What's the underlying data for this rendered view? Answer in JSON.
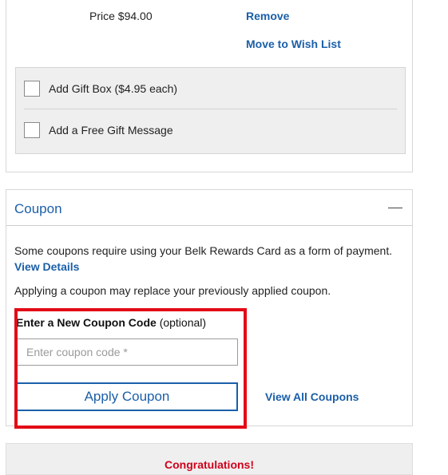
{
  "item": {
    "price": "Price $94.00",
    "remove_label": "Remove",
    "move_to_wishlist_label": "Move to Wish List"
  },
  "gift_options": [
    {
      "label": "Add Gift Box ($4.95 each)",
      "checked": false
    },
    {
      "label": "Add a Free Gift Message",
      "checked": false
    }
  ],
  "coupon": {
    "title": "Coupon",
    "info_text": "Some coupons require using your Belk Rewards Card as a form of payment.",
    "view_details_label": "View Details",
    "replace_notice": "Applying a coupon may replace your previously applied coupon.",
    "entry_label_bold": "Enter a New Coupon Code",
    "entry_label_optional": "(optional)",
    "input_value": "",
    "input_placeholder": "Enter coupon code *",
    "apply_button_label": "Apply Coupon",
    "view_all_label": "View All Coupons"
  },
  "congrats": {
    "text": "Congratulations!"
  },
  "colors": {
    "link": "#1b5fa8",
    "highlight": "#e30b16",
    "congrats": "#d0021b"
  }
}
